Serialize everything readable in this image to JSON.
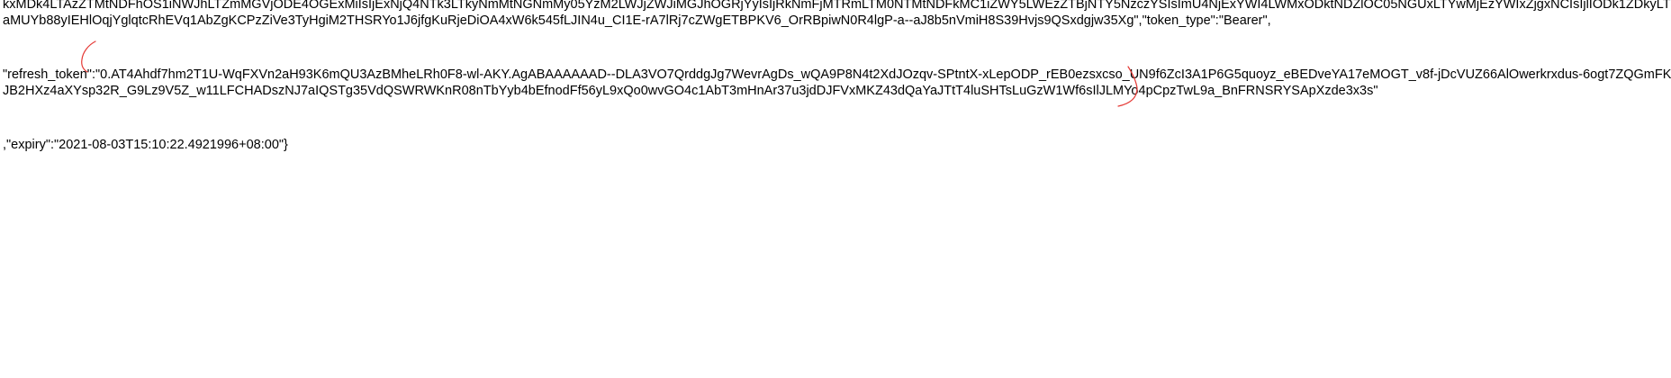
{
  "document": {
    "lines": [
      "kxMDk4LTAzZTMtNDFhOS1iNWJhLTZmMGVjODE4OGExMiIsIjExNjQ4NTk3LTkyNmMtNGNmMy05YzM2LWJjZWJiMGJhOGRjYyIsIjRkNmFjMTRmLTM0NTMtNDFkMC1iZWY5LWEzZTBjNTY5NzczYSIsImU4NjExYWI4LWMxODktNDZlOC05NGUxLTYwMjEzYWIxZjgxNCIsIjlIODk1ZDkyLT",
      "aMUYb88yIEHlOqjYglqtcRhEVq1AbZgKCPzZiVe3TyHgiM2THSRYo1J6jfgKuRjeDiOA4xW6k545fLJIN4u_CI1E-rA7lRj7cZWgETBPKV6_OrRBpiwN0R4lgP-a--aJ8b5nVmiH8S39Hvjs9QSxdgjw35Xg\",\"token_type\":\"Bearer\",",
      "\"refresh_token\":\"0.AT4Ahdf7hm2T1U-WqFXVn2aH93K6mQU3AzBMheLRh0F8-wl-AKY.AgABAAAAAAD--DLA3VO7QrddgJg7WevrAgDs_wQA9P8N4t2XdJOzqv-SPtntX-xLepODP_rEB0ezsxcso_UN9f6ZcI3A1P6G5quoyz_eBEDveYA17eMOGT_v8f-jDcVUZ66AlOwerkrxdus-6ogt7ZQGmFK",
      "JB2HXz4aXYsp32R_G9Lz9V5Z_w11LFCHADszNJ7aIQSTg35VdQSWRWKnR08nTbYyb4bEfnodFf56yL9xQo0wvGO4c1AbT3mHnAr37u3jdDJFVxMKZ43dQaYaJTtT4luSHTsLuGzW1Wf6sIlJLMYo4pCpzTwL9a_BnFRNSRYSApXzde3x3s\"",
      ",\"expiry\":\"2021-08-03T15:10:22.4921996+08:00\"}"
    ]
  },
  "annotations": {
    "color": "#e53935"
  }
}
